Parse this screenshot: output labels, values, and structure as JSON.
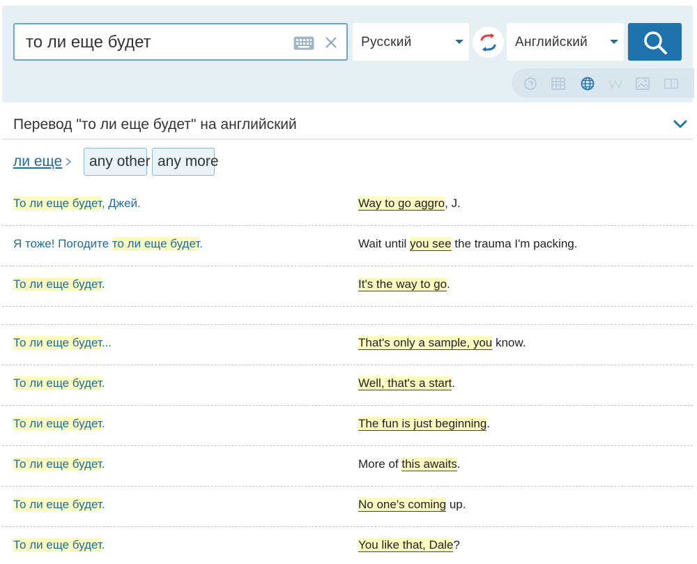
{
  "search": {
    "query": "то ли еще будет",
    "source_lang": "Русский",
    "target_lang": "Английский"
  },
  "section": {
    "title": "Перевод \"то ли еще будет\" на английский"
  },
  "phrase": {
    "link": "ли еще",
    "chips": [
      "any other",
      "any more"
    ]
  },
  "examples": [
    {
      "src": [
        {
          "t": "То ли еще будет",
          "hl": true
        },
        {
          "t": ", Джей."
        }
      ],
      "tgt": [
        {
          "t": "Way to go aggro",
          "hl": true
        },
        {
          "t": ", J."
        }
      ]
    },
    {
      "src": [
        {
          "t": "Я тоже! Погодите "
        },
        {
          "t": "то ли еще будет",
          "hl": true
        },
        {
          "t": "."
        }
      ],
      "tgt": [
        {
          "t": "Wait until "
        },
        {
          "t": "you see",
          "hl": true
        },
        {
          "t": " the trauma I'm packing."
        }
      ]
    },
    {
      "src": [
        {
          "t": "То ли еще будет",
          "hl": true
        },
        {
          "t": "."
        }
      ],
      "tgt": [
        {
          "t": "It's the way to go",
          "hl": true
        },
        {
          "t": "."
        }
      ]
    },
    {
      "src": [],
      "tgt": []
    },
    {
      "src": [
        {
          "t": "То ли еще будет",
          "hl": true
        },
        {
          "t": "..."
        }
      ],
      "tgt": [
        {
          "t": "That's only a sample, you",
          "hl": true
        },
        {
          "t": " know."
        }
      ]
    },
    {
      "src": [
        {
          "t": "То ли еще будет",
          "hl": true
        },
        {
          "t": "."
        }
      ],
      "tgt": [
        {
          "t": "Well, that's a start",
          "hl": true
        },
        {
          "t": "."
        }
      ]
    },
    {
      "src": [
        {
          "t": "То ли еще будет",
          "hl": true
        },
        {
          "t": "."
        }
      ],
      "tgt": [
        {
          "t": "The fun is just beginning",
          "hl": true
        },
        {
          "t": "."
        }
      ]
    },
    {
      "src": [
        {
          "t": "То ли еще будет",
          "hl": true
        },
        {
          "t": "."
        }
      ],
      "tgt": [
        {
          "t": "More of "
        },
        {
          "t": "this awaits",
          "hl": true
        },
        {
          "t": "."
        }
      ]
    },
    {
      "src": [
        {
          "t": "То ли еще будет",
          "hl": true
        },
        {
          "t": "."
        }
      ],
      "tgt": [
        {
          "t": "No one's coming",
          "hl": true
        },
        {
          "t": " up."
        }
      ]
    },
    {
      "src": [
        {
          "t": "То ли еще будет",
          "hl": true
        },
        {
          "t": "."
        }
      ],
      "tgt": [
        {
          "t": "You like that, Dale",
          "hl": true
        },
        {
          "t": "?"
        }
      ]
    }
  ],
  "icons": {
    "keyboard": "keyboard-icon",
    "clear": "close-icon",
    "swap": "swap-arrows-icon",
    "search": "search-icon",
    "sources": [
      "context-icon",
      "table-icon",
      "globe-icon",
      "wiki-icon",
      "image-icon",
      "book-icon"
    ]
  },
  "colors": {
    "accent": "#1e73ad",
    "link": "#1f6b9a",
    "highlight": "#fbfbc0",
    "panel": "#e6eff4"
  }
}
